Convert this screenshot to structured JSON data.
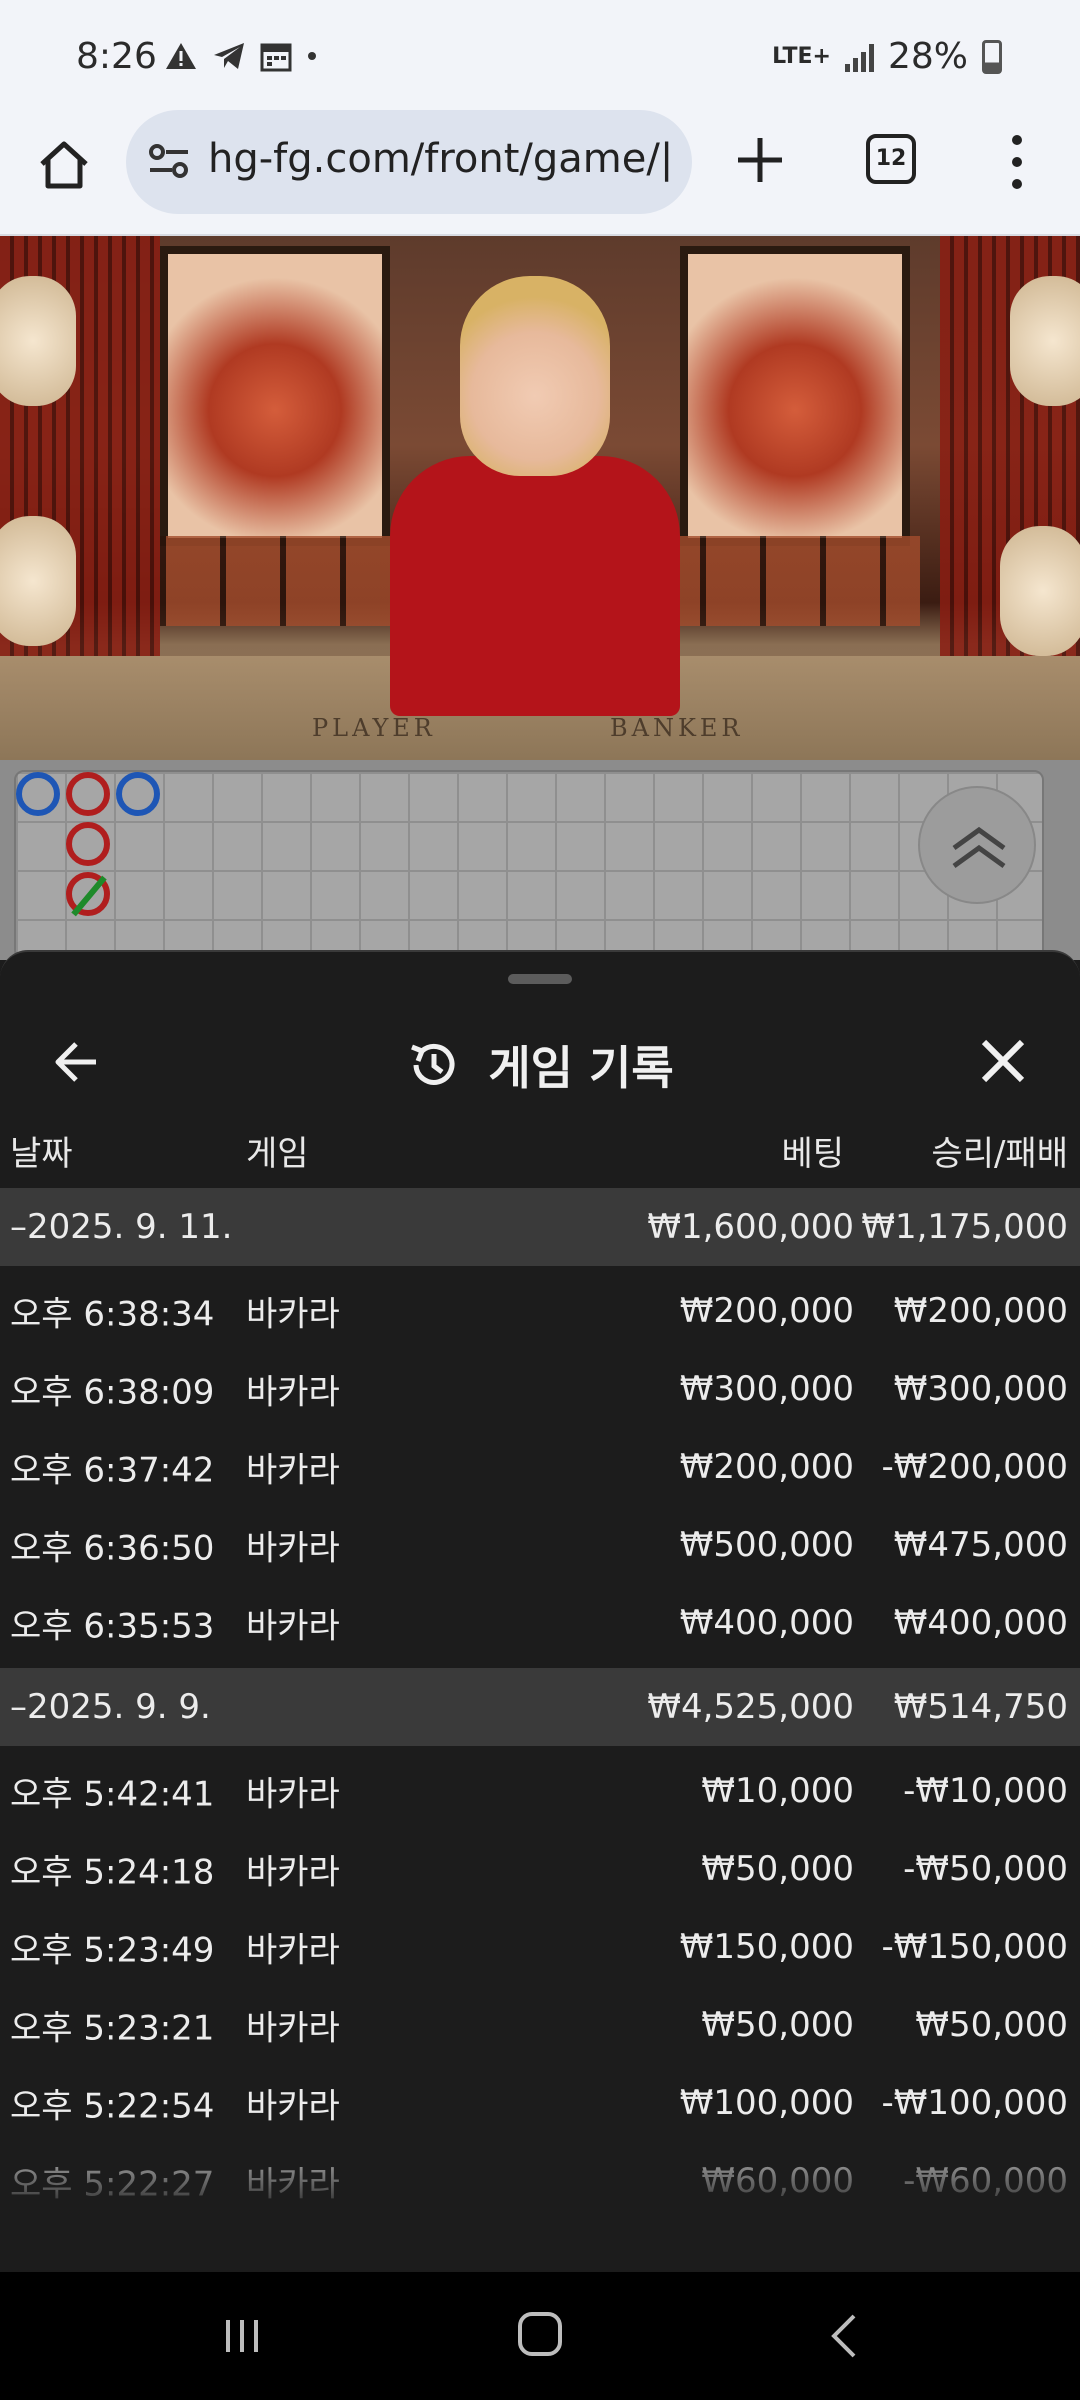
{
  "status_bar": {
    "time": "8:26",
    "network": "LTE+",
    "battery": "28%",
    "icons": [
      "warning-icon",
      "telegram-icon",
      "calendar-icon",
      "dot-icon",
      "signal-icon",
      "battery-icon"
    ]
  },
  "browser": {
    "url": "hg-fg.com/front/game/|",
    "tab_count": "12",
    "icons": [
      "home-icon",
      "site-settings-icon",
      "new-tab-plus-icon",
      "tab-switcher-icon",
      "overflow-menu-icon"
    ]
  },
  "video": {
    "table_labels": [
      "PLAYER",
      "BANKER"
    ]
  },
  "sheet": {
    "title": "게임 기록",
    "columns": {
      "date": "날짜",
      "game": "게임",
      "bet": "베팅",
      "result": "승리/패배"
    },
    "groups": [
      {
        "date": "–2025. 9. 11.",
        "bet_total": "₩1,600,000",
        "result_total": "₩1,175,000",
        "rows": [
          {
            "time": "오후 6:38:34",
            "game": "바카라",
            "bet": "₩200,000",
            "result": "₩200,000"
          },
          {
            "time": "오후 6:38:09",
            "game": "바카라",
            "bet": "₩300,000",
            "result": "₩300,000"
          },
          {
            "time": "오후 6:37:42",
            "game": "바카라",
            "bet": "₩200,000",
            "result": "-₩200,000"
          },
          {
            "time": "오후 6:36:50",
            "game": "바카라",
            "bet": "₩500,000",
            "result": "₩475,000"
          },
          {
            "time": "오후 6:35:53",
            "game": "바카라",
            "bet": "₩400,000",
            "result": "₩400,000"
          }
        ]
      },
      {
        "date": "–2025. 9. 9.",
        "bet_total": "₩4,525,000",
        "result_total": "₩514,750",
        "rows": [
          {
            "time": "오후 5:42:41",
            "game": "바카라",
            "bet": "₩10,000",
            "result": "-₩10,000"
          },
          {
            "time": "오후 5:24:18",
            "game": "바카라",
            "bet": "₩50,000",
            "result": "-₩50,000"
          },
          {
            "time": "오후 5:23:49",
            "game": "바카라",
            "bet": "₩150,000",
            "result": "-₩150,000"
          },
          {
            "time": "오후 5:23:21",
            "game": "바카라",
            "bet": "₩50,000",
            "result": "₩50,000"
          },
          {
            "time": "오후 5:22:54",
            "game": "바카라",
            "bet": "₩100,000",
            "result": "-₩100,000"
          },
          {
            "time": "오후 5:22:27",
            "game": "바카라",
            "bet": "₩60,000",
            "result": "-₩60,000"
          }
        ]
      }
    ]
  },
  "nav_bar": {
    "icons": [
      "recent-apps-icon",
      "home-nav-icon",
      "back-nav-icon"
    ]
  }
}
